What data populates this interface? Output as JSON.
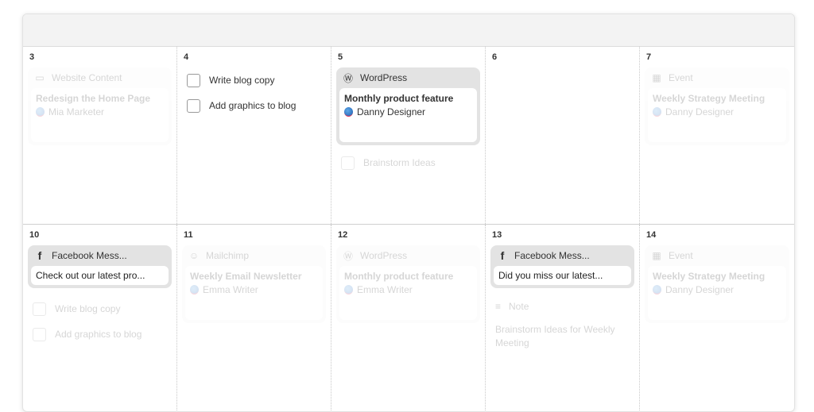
{
  "calendar": {
    "weeks": [
      {
        "days": [
          {
            "day": "3",
            "items": [
              {
                "type": "card",
                "faded": true,
                "icon": "monitor-icon",
                "channel": "Website Content",
                "title": "Redesign the Home Page",
                "author": "Mia Marketer"
              }
            ]
          },
          {
            "day": "4",
            "items": [
              {
                "type": "task",
                "faded": false,
                "label": "Write blog copy"
              },
              {
                "type": "task",
                "faded": false,
                "label": "Add graphics to blog"
              }
            ]
          },
          {
            "day": "5",
            "items": [
              {
                "type": "card",
                "faded": false,
                "icon": "wordpress-icon",
                "channel": "WordPress",
                "title": "Monthly product feature",
                "author": "Danny Designer"
              },
              {
                "type": "task",
                "faded": true,
                "label": "Brainstorm Ideas"
              }
            ]
          },
          {
            "day": "6",
            "items": []
          },
          {
            "day": "7",
            "items": [
              {
                "type": "card",
                "faded": true,
                "icon": "calendar-icon",
                "channel": "Event",
                "title": "Weekly Strategy Meeting",
                "author": "Danny Designer"
              }
            ]
          }
        ]
      },
      {
        "days": [
          {
            "day": "10",
            "items": [
              {
                "type": "message",
                "faded": false,
                "icon": "facebook-icon",
                "channel": "Facebook Mess...",
                "message": "Check out our latest pro..."
              },
              {
                "type": "task",
                "faded": true,
                "label": "Write blog copy"
              },
              {
                "type": "task",
                "faded": true,
                "label": "Add graphics to blog"
              }
            ]
          },
          {
            "day": "11",
            "items": [
              {
                "type": "card",
                "faded": true,
                "icon": "mailchimp-icon",
                "channel": "Mailchimp",
                "title": "Weekly Email Newsletter",
                "author": "Emma Writer"
              }
            ]
          },
          {
            "day": "12",
            "items": [
              {
                "type": "card",
                "faded": true,
                "icon": "wordpress-icon",
                "channel": "WordPress",
                "title": "Monthly product feature",
                "author": "Emma Writer"
              }
            ]
          },
          {
            "day": "13",
            "items": [
              {
                "type": "message",
                "faded": false,
                "icon": "facebook-icon",
                "channel": "Facebook Mess...",
                "message": "Did you miss our latest..."
              },
              {
                "type": "note",
                "faded": true,
                "icon": "note-icon",
                "channel": "Note",
                "text": "Brainstorm Ideas for Weekly Meeting"
              }
            ]
          },
          {
            "day": "14",
            "items": [
              {
                "type": "card",
                "faded": true,
                "icon": "calendar-icon",
                "channel": "Event",
                "title": "Weekly Strategy Meeting",
                "author": "Danny Designer"
              }
            ]
          }
        ]
      }
    ]
  }
}
